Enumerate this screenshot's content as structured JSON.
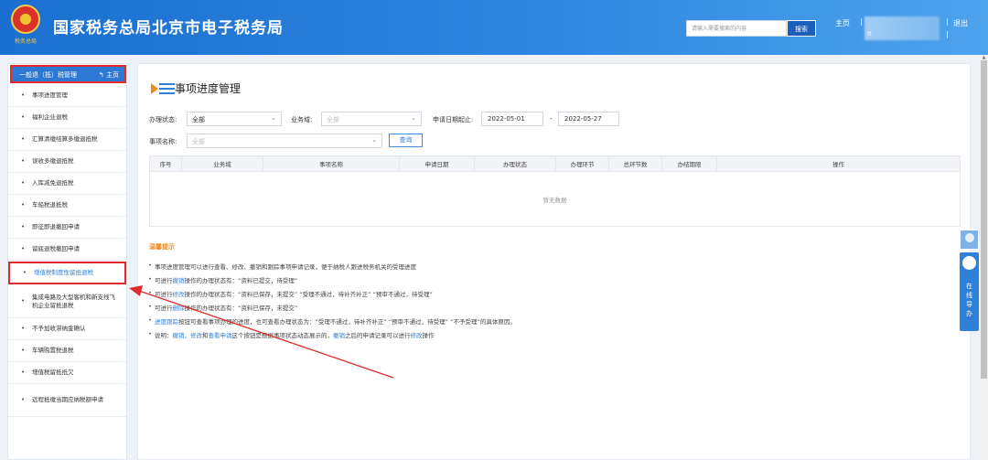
{
  "header": {
    "emblem_text": "税务总局",
    "title": "国家税务总局北京市电子税务局",
    "search_placeholder": "请输入需要搜索的内容",
    "search_button": "搜索",
    "home_link": "主页",
    "sep1": "|",
    "user_fragment": "it",
    "sep2": "|",
    "logout_link": "退出",
    "sep3": "|"
  },
  "sidebar": {
    "header": "一般退（抵）税管理",
    "home": "主页",
    "items": [
      {
        "label": "事项进度管理"
      },
      {
        "label": "福利企业退税"
      },
      {
        "label": "汇算清缴结算多缴退抵税"
      },
      {
        "label": "误收多缴退抵税"
      },
      {
        "label": "入库减免退抵税"
      },
      {
        "label": "车船税退抵税"
      },
      {
        "label": "即征即退撤回申请"
      },
      {
        "label": "留底退税撤回申请"
      },
      {
        "label": "增值税制度性留抵退税",
        "active": true
      },
      {
        "label": "集成电路及大型客机和新支线飞机企业留抵退税"
      },
      {
        "label": "不予加收滞纳金确认"
      },
      {
        "label": "车辆购置税退税"
      },
      {
        "label": "增值税留抵抵欠"
      },
      {
        "label": "远程抵缴当期应纳税额申请"
      }
    ]
  },
  "main": {
    "title": "事项进度管理",
    "filters": {
      "status_label": "办理状态:",
      "status_value": "全部",
      "business_label": "业务域:",
      "business_value": "全部",
      "date_label": "申请日期起止:",
      "date_start": "2022-05-01",
      "date_sep": "-",
      "date_end": "2022-05-27",
      "item_label": "事项名称:",
      "item_value": "全部",
      "query_button": "查询"
    },
    "table": {
      "columns": [
        "序号",
        "业务域",
        "事项名称",
        "申请日期",
        "办理状态",
        "办理环节",
        "总环节数",
        "办结期限",
        "操作"
      ],
      "empty_text": "暂无数据"
    },
    "tips": {
      "title": "温馨提示",
      "lines": [
        [
          {
            "t": "事项进度管理可以进行查看、修改、撤销和跟踪事项申请记录，便于纳税人跟进税务机关的受理进度"
          }
        ],
        [
          {
            "t": "可进行"
          },
          {
            "t": "撤销",
            "hl": true
          },
          {
            "t": "操作的办理状态有：“资料已提交，待受理”"
          }
        ],
        [
          {
            "t": "可进行"
          },
          {
            "t": "修改",
            "hl": true
          },
          {
            "t": "操作的办理状态有：“资料已保存，未提交”  “受理不通过，待补齐补正”  “预审不通过，待受理”"
          }
        ],
        [
          {
            "t": "可进行"
          },
          {
            "t": "删除",
            "hl": true
          },
          {
            "t": "操作的办理状态有：“资料已保存，未提交”"
          }
        ],
        [
          {
            "t": "进度跟踪",
            "hl": true
          },
          {
            "t": "按钮可查看事项办理的进度，也可查看办理状态为：“受理不通过，待补齐补正”  “预审不通过，待受理”  “不予受理”的具体原因。"
          }
        ],
        [
          {
            "t": "说明："
          },
          {
            "t": "撤销、修改",
            "hl": true
          },
          {
            "t": "和"
          },
          {
            "t": "查看申请",
            "hl": true
          },
          {
            "t": "这个按钮是根据事项状态动态展示的，"
          },
          {
            "t": "撤销",
            "hl": true
          },
          {
            "t": "之后的申请记录可以进行"
          },
          {
            "t": "修改",
            "hl": true
          },
          {
            "t": "操作"
          }
        ]
      ]
    }
  },
  "float": {
    "text": "在线导办"
  },
  "colors": {
    "accent": "#2f80d9",
    "highlight_border": "#e12a2a",
    "tip_title": "#f08a1e",
    "annotation_arrow": "#e12a2a"
  }
}
